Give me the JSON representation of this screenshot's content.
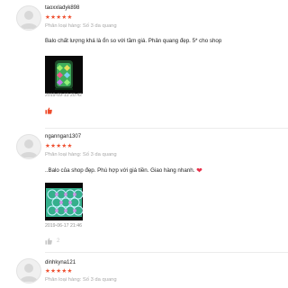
{
  "reviews": [
    {
      "username": "taoxxladyk898",
      "stars": "★★★★★",
      "rating": 5,
      "variation": "Phân loại hàng: Số 3 da quang",
      "comment": "Balo chất lượng khá là ổn so với tầm giá. Phản quang đẹp. 5* cho shop",
      "timestamp": "2019-09-13 20:42",
      "likes": "",
      "like_active": true
    },
    {
      "username": "nganngan1307",
      "stars": "★★★★★",
      "rating": 5,
      "variation": "Phân loại hàng: Số 3 da quang",
      "comment": "..Balo của shop đẹp. Phù hợp với giá tiền. Giao hàng nhanh.",
      "comment_icon": "heart-emoji",
      "timestamp": "2019-06-17 21:46",
      "likes": "2",
      "like_active": false
    },
    {
      "username": "dinhkyna121",
      "stars": "★★★★★",
      "rating": 5,
      "variation": "Phân loại hàng: Số 3 da quang"
    }
  ],
  "colors": {
    "star": "#ee4d2d",
    "like_active": "#ee4d2d",
    "like_inactive": "#c7c7c7",
    "heart": "#e8304a",
    "variation_text": "#a8a8a8",
    "timestamp_text": "#8f8f8f",
    "divider": "#ececec"
  },
  "icons": [
    "avatar-placeholder-icon",
    "thumbs-up-icon",
    "heart-emoji"
  ]
}
